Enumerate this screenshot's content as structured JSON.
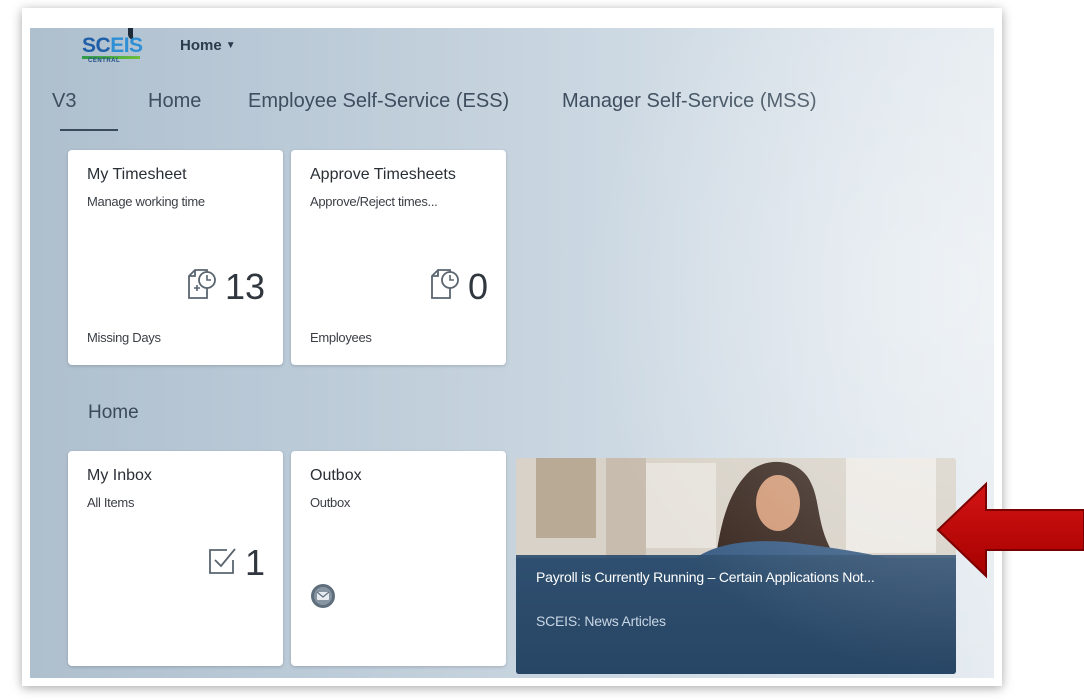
{
  "header": {
    "logo_text_main": "SC",
    "logo_text_accent": "EIS",
    "logo_sub": "CENTRAL",
    "menu_label": "Home",
    "menu_caret": "▼"
  },
  "tabs": [
    {
      "label": "V3",
      "active": true
    },
    {
      "label": "Home",
      "active": false
    },
    {
      "label": "Employee Self-Service (ESS)",
      "active": false
    },
    {
      "label": "Manager Self-Service (MSS)",
      "active": false
    }
  ],
  "tiles_top": [
    {
      "title": "My Timesheet",
      "subtitle": "Manage working time",
      "value": "13",
      "footer": "Missing Days",
      "icon": "timesheet-add-icon"
    },
    {
      "title": "Approve Timesheets",
      "subtitle": "Approve/Reject times...",
      "value": "0",
      "footer": "Employees",
      "icon": "timesheet-approve-icon"
    }
  ],
  "group": {
    "title": "Home"
  },
  "tiles_bottom": [
    {
      "title": "My Inbox",
      "subtitle": "All Items",
      "value": "1",
      "icon": "inbox-checkbox-icon"
    },
    {
      "title": "Outbox",
      "subtitle": "Outbox",
      "icon": "outbox-envelope-icon"
    }
  ],
  "news": {
    "headline": "Payroll is Currently Running – Certain Applications Not...",
    "source": "SCEIS: News Articles"
  },
  "colors": {
    "accent_blue": "#1f5fa8",
    "news_overlay": "#2f4f70",
    "arrow_red": "#c00000"
  }
}
